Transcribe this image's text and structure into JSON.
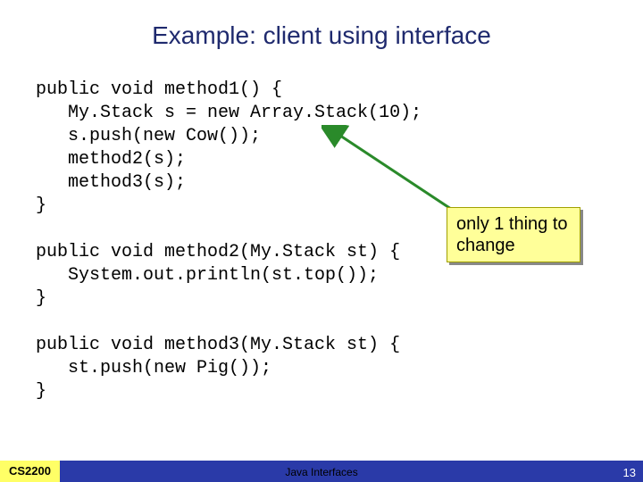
{
  "title": "Example: client using interface",
  "code": "public void method1() {\n   My.Stack s = new Array.Stack(10);\n   s.push(new Cow());\n   method2(s);\n   method3(s);\n}\n\npublic void method2(My.Stack st) {\n   System.out.println(st.top());\n}\n\npublic void method3(My.Stack st) {\n   st.push(new Pig());\n}",
  "callout": "only 1 thing to change",
  "footer": {
    "course": "CS2200",
    "center": "Java Interfaces",
    "page": "13"
  }
}
